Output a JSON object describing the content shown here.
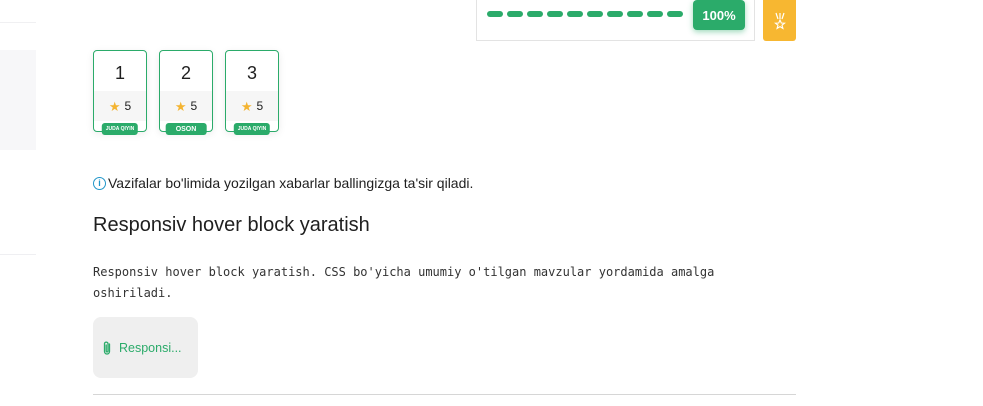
{
  "progress": {
    "segments": 10,
    "value_label": "100%",
    "accent": "#2bab6a"
  },
  "medal_button": {
    "icon": "medal-icon",
    "color": "#f7b731"
  },
  "tasks": [
    {
      "number": "1",
      "score": "5",
      "difficulty": "JUDA QIYIN"
    },
    {
      "number": "2",
      "score": "5",
      "difficulty": "OSON"
    },
    {
      "number": "3",
      "score": "5",
      "difficulty": "JUDA QIYIN"
    }
  ],
  "notice": {
    "icon": "info-icon",
    "text": "Vazifalar bo'limida yozilgan xabarlar ballingizga ta'sir qiladi."
  },
  "task": {
    "title": "Responsiv hover block yaratish",
    "description": "Responsiv hover block yaratish. CSS bo'yicha umumiy o'tilgan mavzular yordamida amalga oshiriladi."
  },
  "attachment": {
    "icon": "paperclip-icon",
    "label": "Responsi..."
  }
}
